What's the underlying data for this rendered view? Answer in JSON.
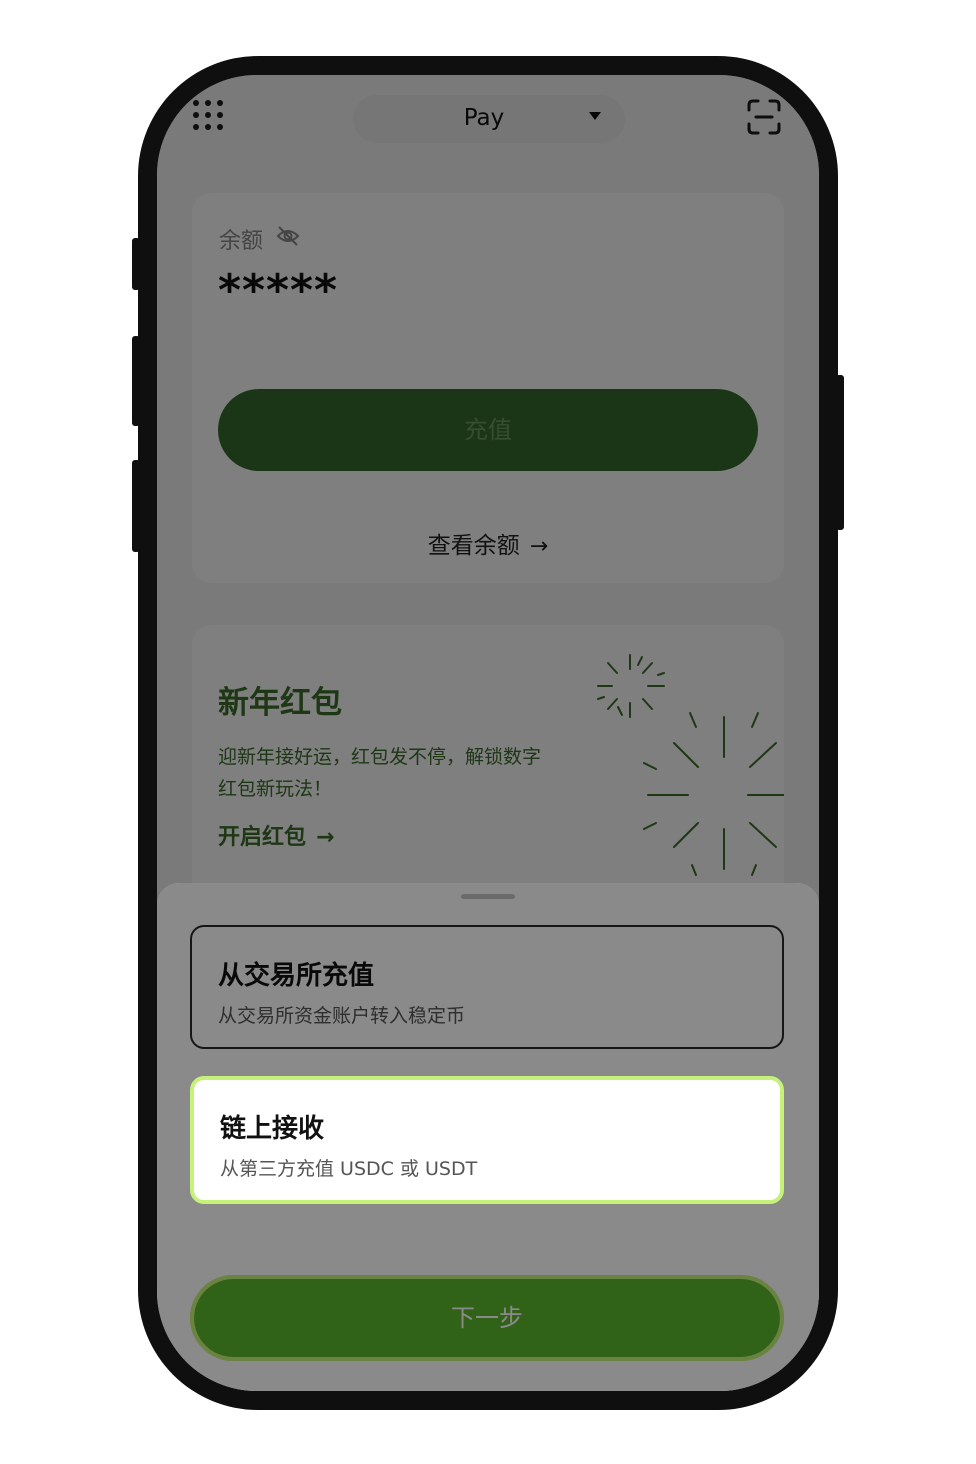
{
  "topbar": {
    "app_switch_label": "Pay"
  },
  "balance": {
    "label": "余额",
    "masked_value": "*****",
    "topup_label": "充值",
    "view_label": "查看余额",
    "view_arrow": "→"
  },
  "promo": {
    "title": "新年红包",
    "description": "迎新年接好运，红包发不停，解锁数字红包新玩法！",
    "cta": "开启红包",
    "cta_arrow": "→"
  },
  "sheet": {
    "options": [
      {
        "title": "从交易所充值",
        "subtitle": "从交易所资金账户转入稳定币",
        "selected": false
      },
      {
        "title": "链上接收",
        "subtitle": "从第三方充值 USDC 或 USDT",
        "selected": true
      }
    ],
    "next_label": "下一步"
  },
  "colors": {
    "accent_green": "#5ab52c",
    "highlight_lime": "#c6f27a",
    "dark_green": "#356c2c",
    "overlay": "rgba(0,0,0,0.5)"
  },
  "icons": {
    "apps": "apps-grid-icon",
    "dropdown": "caret-down-icon",
    "scan": "scan-icon",
    "eye": "eye-off-icon",
    "arrow": "arrow-right-icon",
    "burst": "firework-burst-icon"
  }
}
